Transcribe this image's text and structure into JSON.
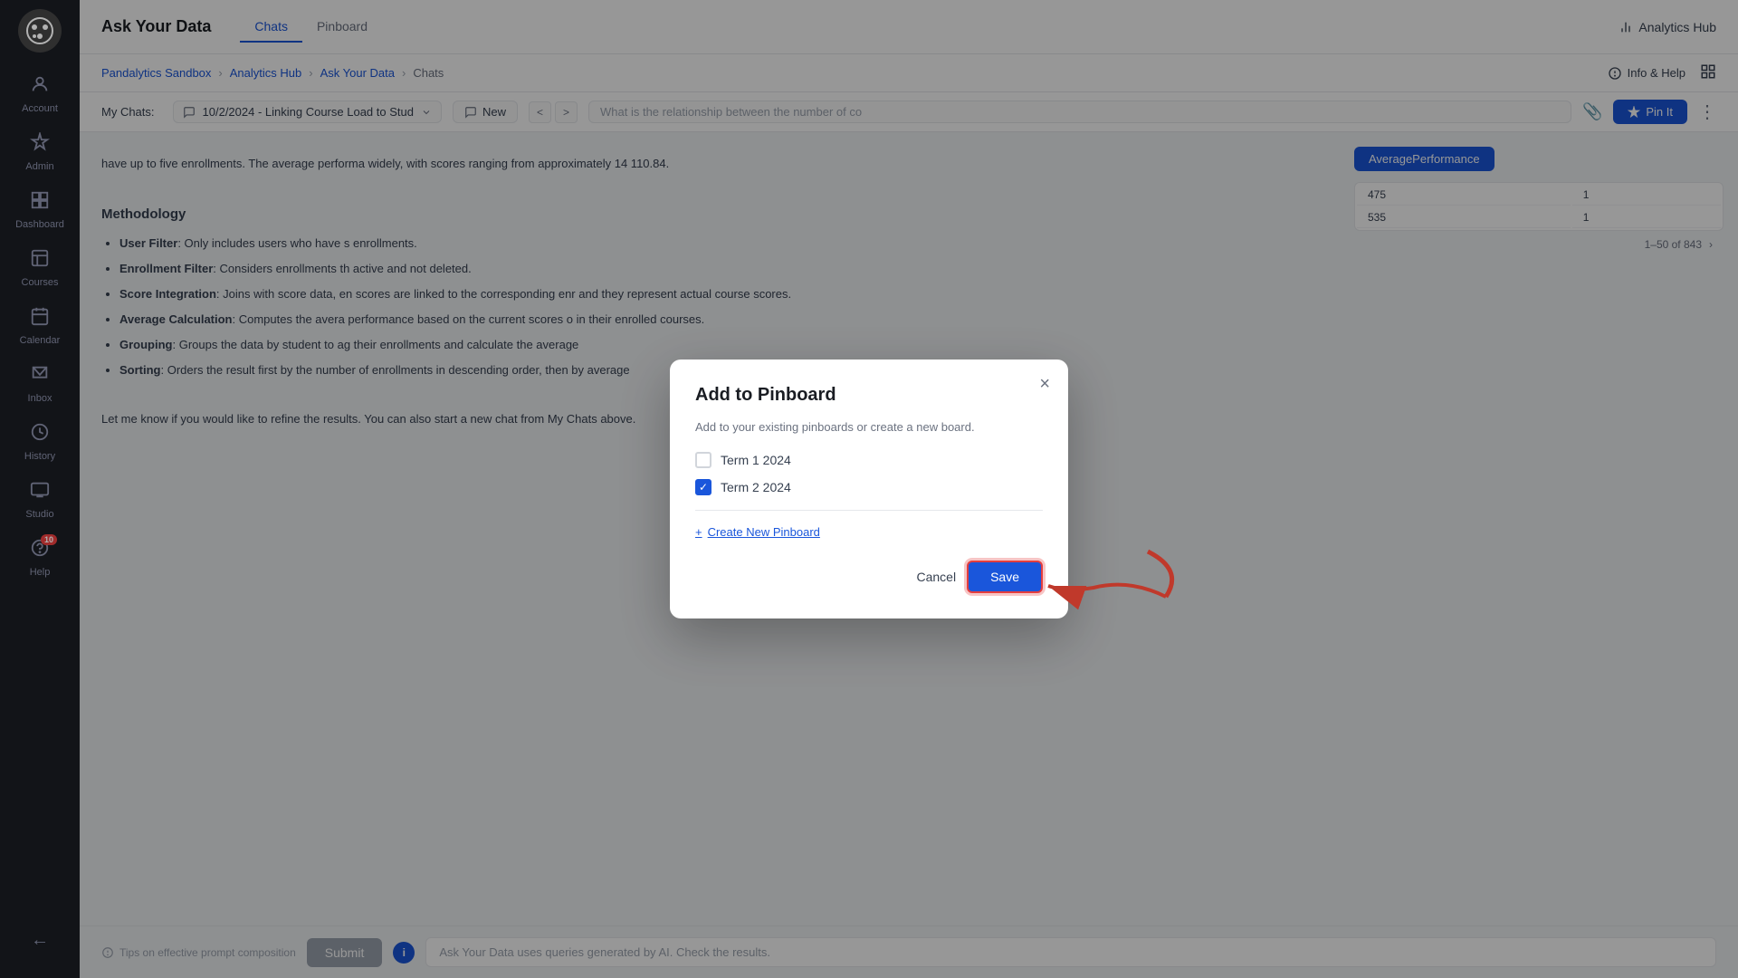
{
  "sidebar": {
    "logo_alt": "App Logo",
    "items": [
      {
        "id": "account",
        "label": "Account",
        "icon": "👤"
      },
      {
        "id": "admin",
        "label": "Admin",
        "icon": "⚙"
      },
      {
        "id": "dashboard",
        "label": "Dashboard",
        "icon": "⊞"
      },
      {
        "id": "courses",
        "label": "Courses",
        "icon": "📋"
      },
      {
        "id": "calendar",
        "label": "Calendar",
        "icon": "📅"
      },
      {
        "id": "inbox",
        "label": "Inbox",
        "icon": "✉"
      },
      {
        "id": "history",
        "label": "History",
        "icon": "🕐"
      },
      {
        "id": "studio",
        "label": "Studio",
        "icon": "📺"
      },
      {
        "id": "help",
        "label": "Help",
        "icon": "❓",
        "badge": "10"
      }
    ],
    "collapse_icon": "←"
  },
  "topnav": {
    "title": "Ask Your Data",
    "tabs": [
      {
        "id": "chats",
        "label": "Chats",
        "active": true
      },
      {
        "id": "pinboard",
        "label": "Pinboard",
        "active": false
      }
    ],
    "analytics_hub": "Analytics Hub"
  },
  "breadcrumb": {
    "items": [
      "Pandalytics Sandbox",
      "Analytics Hub",
      "Ask Your Data",
      "Chats"
    ],
    "info_help": "Info & Help"
  },
  "chat_toolbar": {
    "my_chats_label": "My Chats:",
    "selected_chat": "10/2/2024 - Linking Course Load to Stud",
    "new_label": "New",
    "prev_icon": "<",
    "next_icon": ">",
    "search_placeholder": "What is the relationship between the number of co",
    "pin_it": "Pin It",
    "more_icon": "⋮"
  },
  "content": {
    "intro_text": "have up to five enrollments. The average performa widely, with scores ranging from approximately 14 110.84.",
    "methodology_title": "Methodology",
    "items": [
      {
        "label": "User Filter",
        "text": "Only includes users who have s enrollments."
      },
      {
        "label": "Enrollment Filter",
        "text": "Considers enrollments th active and not deleted."
      },
      {
        "label": "Score Integration",
        "text": "Joins with score data, en scores are linked to the corresponding enr and they represent actual course scores."
      },
      {
        "label": "Average Calculation",
        "text": "Computes the avera performance based on the current scores o in their enrolled courses."
      },
      {
        "label": "Grouping",
        "text": "Groups the data by student to ag their enrollments and calculate the average"
      },
      {
        "label": "Sorting",
        "text": "Orders the result first by the number of enrollments in descending order, then by average"
      }
    ],
    "closing_text": "Let me know if you would like to refine the results. You can also start a new chat from My Chats above."
  },
  "table": {
    "avg_perf_badge": "AveragePerformance",
    "rows": [
      {
        "col1": "475",
        "col2": "1"
      },
      {
        "col1": "535",
        "col2": "1"
      }
    ],
    "pagination": "1–50 of 843"
  },
  "submit_bar": {
    "tips_label": "Tips on effective prompt composition",
    "submit_btn": "Submit",
    "ai_badge": "i",
    "prompt_placeholder": "Ask Your Data uses queries generated by AI. Check the results."
  },
  "modal": {
    "title": "Add to Pinboard",
    "close_icon": "×",
    "subtitle": "Add to your existing pinboards or create a new board.",
    "pinboards": [
      {
        "id": "term1",
        "label": "Term 1 2024",
        "checked": false
      },
      {
        "id": "term2",
        "label": "Term 2 2024",
        "checked": true
      }
    ],
    "create_new": "Create New Pinboard",
    "cancel_btn": "Cancel",
    "save_btn": "Save"
  },
  "colors": {
    "primary": "#1a56db",
    "danger": "#e53e3e",
    "sidebar_bg": "#1a1d23",
    "text_dark": "#1a1d23",
    "text_muted": "#6b7280"
  }
}
